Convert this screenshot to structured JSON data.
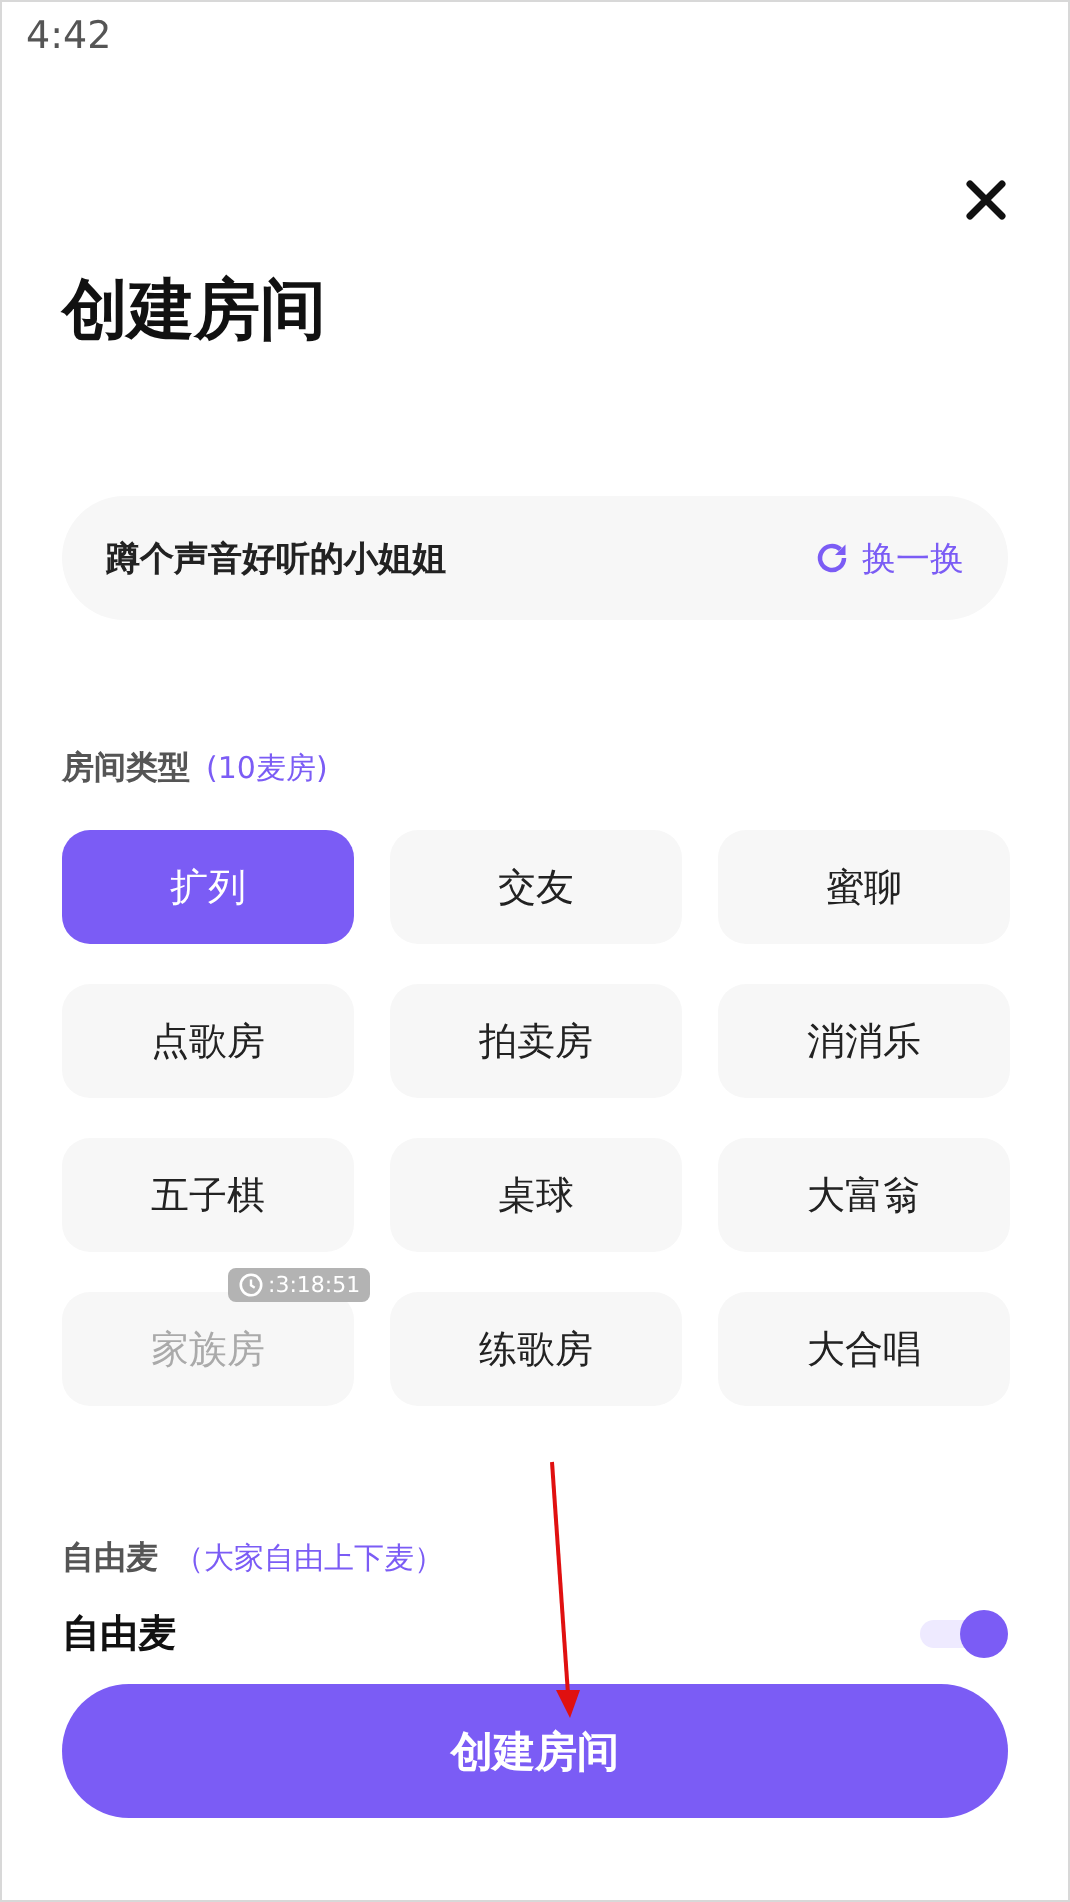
{
  "status_bar": {
    "time": "4:42"
  },
  "title": "创建房间",
  "topic": {
    "text": "蹲个声音好听的小姐姐",
    "refresh_label": "换一换"
  },
  "room_type": {
    "label": "房间类型",
    "hint": "(10麦房)",
    "options": [
      {
        "label": "扩列",
        "selected": true,
        "disabled": false
      },
      {
        "label": "交友",
        "selected": false,
        "disabled": false
      },
      {
        "label": "蜜聊",
        "selected": false,
        "disabled": false
      },
      {
        "label": "点歌房",
        "selected": false,
        "disabled": false
      },
      {
        "label": "拍卖房",
        "selected": false,
        "disabled": false
      },
      {
        "label": "消消乐",
        "selected": false,
        "disabled": false
      },
      {
        "label": "五子棋",
        "selected": false,
        "disabled": false
      },
      {
        "label": "桌球",
        "selected": false,
        "disabled": false
      },
      {
        "label": "大富翁",
        "selected": false,
        "disabled": false
      },
      {
        "label": "家族房",
        "selected": false,
        "disabled": true,
        "timer": ":3:18:51"
      },
      {
        "label": "练歌房",
        "selected": false,
        "disabled": false
      },
      {
        "label": "大合唱",
        "selected": false,
        "disabled": false
      }
    ]
  },
  "free_mic": {
    "label": "自由麦",
    "hint": "（大家自由上下麦）",
    "toggle_label": "自由麦",
    "on": true
  },
  "create_button": "创建房间"
}
